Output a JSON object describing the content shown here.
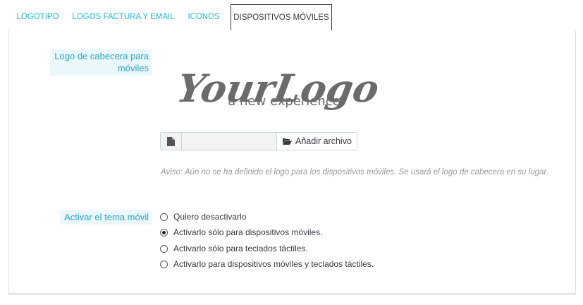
{
  "tabs": [
    {
      "label": "LOGOTIPO"
    },
    {
      "label": "LOGOS FACTURA Y EMAIL"
    },
    {
      "label": "ICONOS"
    },
    {
      "label": "DISPOSITIVOS MÓVILES"
    }
  ],
  "mobile_logo": {
    "label": "Logo de cabecera para\nmóviles",
    "logo_text": "YourLogo",
    "logo_tagline": "a new experience",
    "add_file_label": "Añadir archivo",
    "help_text": "Aviso: Aún no se ha definido el logo para los dispositivos móviles. Se usará el logo de cabecera en su lugar."
  },
  "mobile_theme": {
    "label": "Activar el tema móvil",
    "options": [
      {
        "label": "Quiero desactivarlo",
        "checked": false
      },
      {
        "label": "Activarlo sólo para dispositivos móviles.",
        "checked": true
      },
      {
        "label": "Activarlo sólo para teclados táctiles.",
        "checked": false
      },
      {
        "label": "Activarlo para dispositivos móviles y teclados táctiles.",
        "checked": false
      }
    ]
  },
  "colors": {
    "accent": "#25b9d7",
    "text": "#363a41",
    "label_bg": "#eaf7fb",
    "help_text": "#999999"
  }
}
